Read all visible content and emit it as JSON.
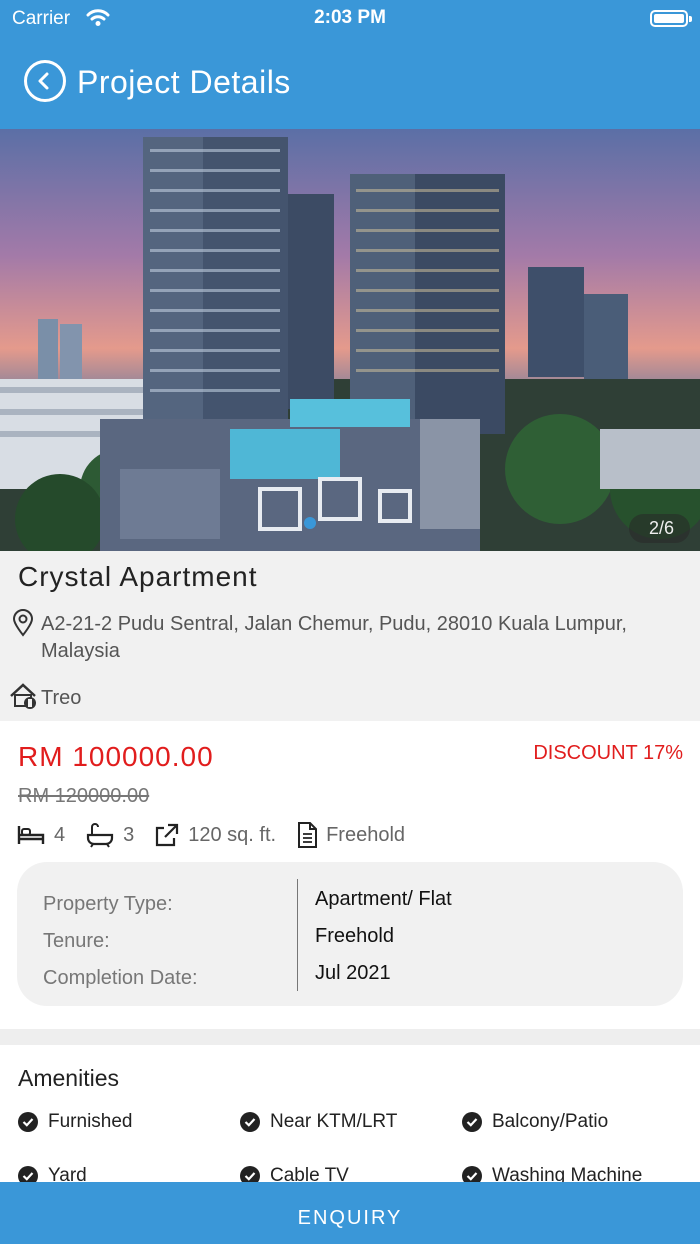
{
  "status_bar": {
    "carrier": "Carrier",
    "time": "2:03 PM"
  },
  "nav": {
    "title": "Project Details"
  },
  "gallery": {
    "counter": "2/6"
  },
  "property": {
    "name": "Crystal Apartment",
    "address": "A2-21-2 Pudu Sentral, Jalan Chemur, Pudu, 28010 Kuala Lumpur, Malaysia",
    "developer": "Treo"
  },
  "pricing": {
    "price": "RM 100000.00",
    "discount": "DISCOUNT 17%",
    "original_price": "RM 120000.00"
  },
  "specs": {
    "bedrooms": "4",
    "bathrooms": "3",
    "size": "120 sq. ft.",
    "tenure": "Freehold"
  },
  "details": {
    "labels": [
      "Property Type:",
      "Tenure:",
      "Completion Date:"
    ],
    "values": [
      "Apartment/ Flat",
      "Freehold",
      "Jul 2021"
    ]
  },
  "amenities": {
    "title": "Amenities",
    "items": [
      "Furnished",
      "Near KTM/LRT",
      "Balcony/Patio",
      "Yard",
      "Cable TV",
      "Washing Machine"
    ]
  },
  "footer": {
    "enquiry_label": "ENQUIRY"
  },
  "colors": {
    "primary": "#3a97d8",
    "price_red": "#e11d1d",
    "card_bg": "#f1f1f1"
  }
}
